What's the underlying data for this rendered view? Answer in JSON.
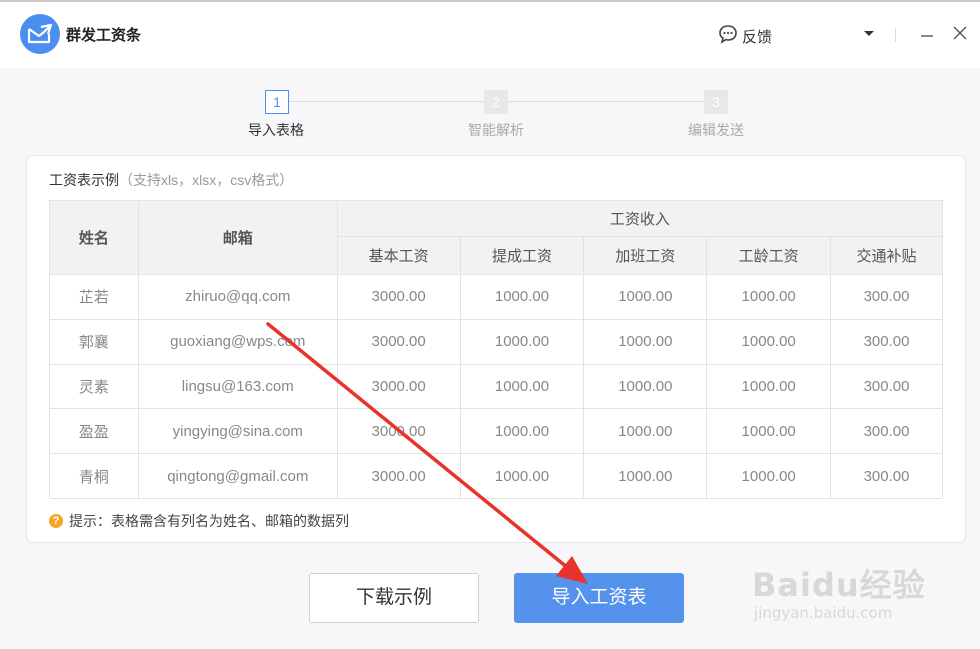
{
  "app": {
    "title": "群发工资条"
  },
  "titlebar": {
    "feedback_label": "反馈"
  },
  "steps": [
    {
      "number": "1",
      "label": "导入表格"
    },
    {
      "number": "2",
      "label": "智能解析"
    },
    {
      "number": "3",
      "label": "编辑发送"
    }
  ],
  "card": {
    "title": "工资表示例",
    "subtitle": "（支持xls，xlsx，csv格式）",
    "table": {
      "col_name": "姓名",
      "col_email": "邮箱",
      "group_header": "工资收入",
      "sub_headers": [
        "基本工资",
        "提成工资",
        "加班工资",
        "工龄工资",
        "交通补贴"
      ],
      "rows": [
        [
          "芷若",
          "zhiruo@qq.com",
          "3000.00",
          "1000.00",
          "1000.00",
          "1000.00",
          "300.00"
        ],
        [
          "郭襄",
          "guoxiang@wps.com",
          "3000.00",
          "1000.00",
          "1000.00",
          "1000.00",
          "300.00"
        ],
        [
          "灵素",
          "lingsu@163.com",
          "3000.00",
          "1000.00",
          "1000.00",
          "1000.00",
          "300.00"
        ],
        [
          "盈盈",
          "yingying@sina.com",
          "3000.00",
          "1000.00",
          "1000.00",
          "1000.00",
          "300.00"
        ],
        [
          "青桐",
          "qingtong@gmail.com",
          "3000.00",
          "1000.00",
          "1000.00",
          "1000.00",
          "300.00"
        ]
      ]
    },
    "tip_icon": "?",
    "tip": "提示：表格需含有列名为姓名、邮箱的数据列"
  },
  "buttons": {
    "download_sample": "下载示例",
    "import_payroll": "导入工资表"
  },
  "watermark": {
    "brand": "Baidu经验",
    "url": "jingyan.baidu.com"
  },
  "colors": {
    "accent": "#4a8ff0",
    "primary_button": "#5592ec",
    "tip_icon": "#f5a623",
    "arrow": "#e8322b"
  },
  "icons": {
    "logo": "envelope-arrow-icon",
    "feedback": "chat-bubble-icon",
    "dropdown": "triangle-down-icon",
    "minimize": "minimize-icon",
    "close": "close-icon"
  }
}
